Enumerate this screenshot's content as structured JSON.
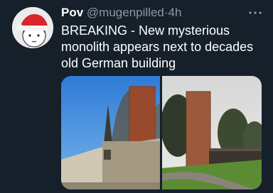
{
  "tweet": {
    "display_name": "Pov",
    "handle": "@mugenpilled",
    "separator": "·",
    "time": "4h",
    "more_icon": "more-horizontal-icon",
    "text": "BREAKING - New mysterious monolith appears next to decades old German building"
  },
  "media": {
    "count": 2
  },
  "colors": {
    "background": "#15202b",
    "secondary_text": "#8899a6",
    "primary_text": "#ffffff"
  }
}
